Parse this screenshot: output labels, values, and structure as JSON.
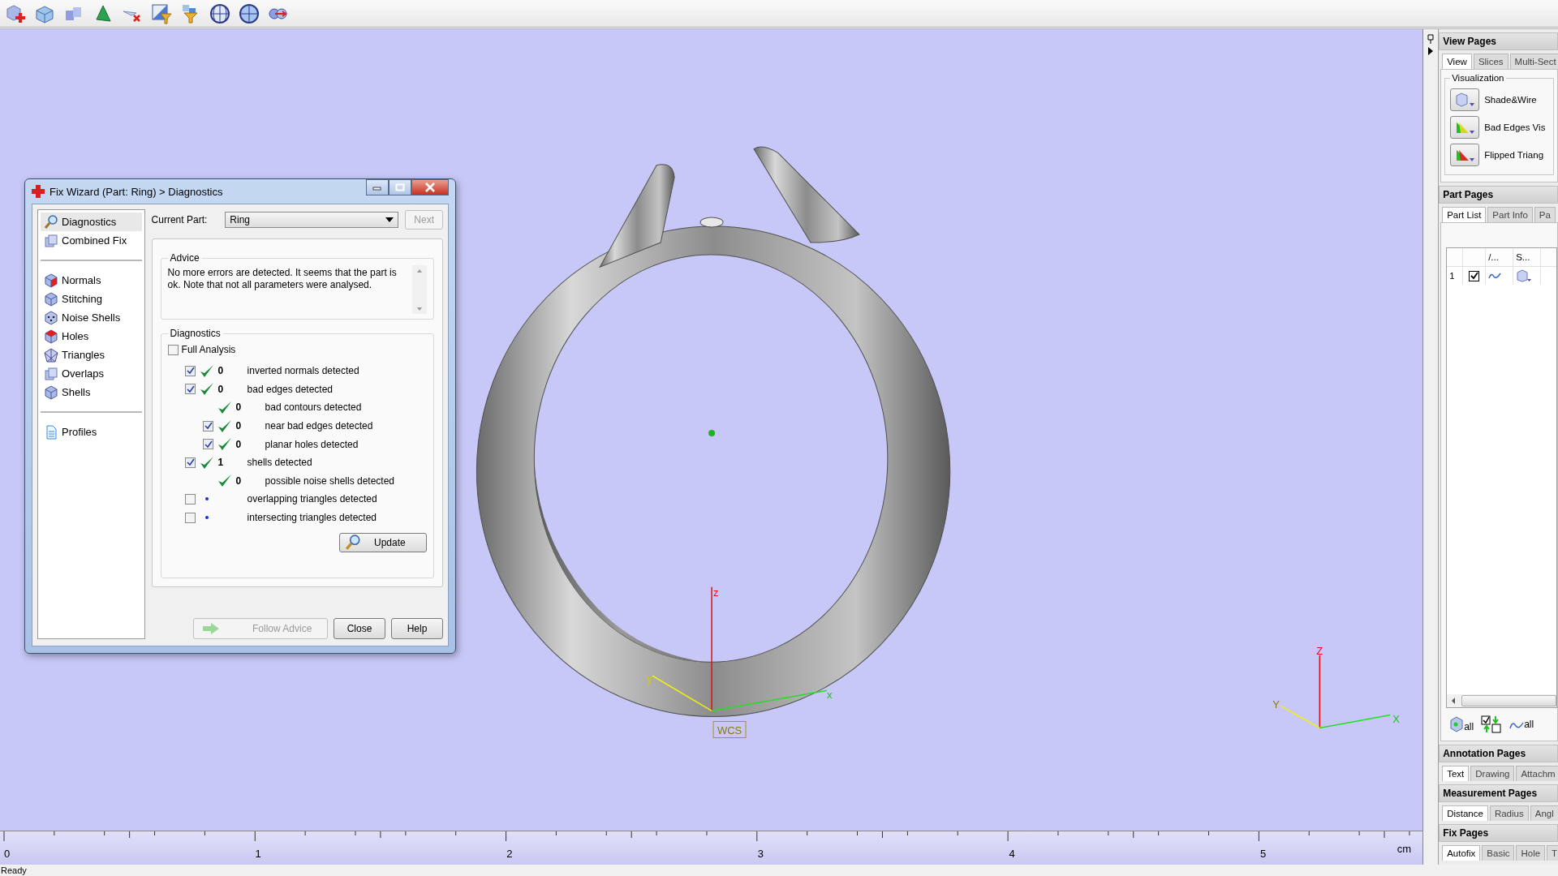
{
  "viewport": {
    "axis_labels": {
      "z": "z",
      "x": "x",
      "y": "y",
      "wcs": "WCS"
    },
    "corner_axes": {
      "z": "Z",
      "x": "X",
      "y": "Y"
    },
    "ruler": {
      "labels": [
        "0",
        "1",
        "2",
        "3",
        "4",
        "5"
      ],
      "unit": "cm"
    }
  },
  "dialog": {
    "title": "Fix Wizard (Part: Ring) > Diagnostics",
    "nav": [
      {
        "label": "Diagnostics",
        "selected": true
      },
      {
        "label": "Combined Fix",
        "selected": false
      },
      {
        "label": "Normals",
        "selected": false
      },
      {
        "label": "Stitching",
        "selected": false
      },
      {
        "label": "Noise Shells",
        "selected": false
      },
      {
        "label": "Holes",
        "selected": false
      },
      {
        "label": "Triangles",
        "selected": false
      },
      {
        "label": "Overlaps",
        "selected": false
      },
      {
        "label": "Shells",
        "selected": false
      },
      {
        "label": "Profiles",
        "selected": false
      }
    ],
    "current_part_label": "Current Part:",
    "current_part": "Ring",
    "next_button": {
      "label": "Next",
      "disabled": true
    },
    "advice": {
      "title": "Advice",
      "text": "No more errors are detected. It seems that the part is ok. Note that not all parameters were analysed."
    },
    "diagnostics": {
      "title": "Diagnostics",
      "full_analysis": {
        "label": "Full Analysis",
        "checked": false
      },
      "rows": [
        {
          "kind": "checkbox",
          "checked": true,
          "analysed": true,
          "count": "0",
          "label": "inverted normals detected"
        },
        {
          "kind": "checkbox",
          "checked": true,
          "analysed": true,
          "count": "0",
          "label": "bad edges detected",
          "children": [
            {
              "kind": "plain",
              "analysed": true,
              "count": "0",
              "label": "bad contours detected"
            },
            {
              "kind": "checkbox",
              "checked": true,
              "analysed": true,
              "count": "0",
              "label": "near bad edges detected"
            },
            {
              "kind": "checkbox",
              "checked": true,
              "analysed": true,
              "count": "0",
              "label": "planar holes detected"
            }
          ]
        },
        {
          "kind": "checkbox",
          "checked": true,
          "analysed": true,
          "count": "1",
          "label": "shells detected",
          "children": [
            {
              "kind": "plain",
              "analysed": true,
              "count": "0",
              "label": "possible noise shells detected"
            }
          ]
        },
        {
          "kind": "checkbox",
          "checked": false,
          "analysed": false,
          "label": "overlapping triangles detected"
        },
        {
          "kind": "checkbox",
          "checked": false,
          "analysed": false,
          "label": "intersecting triangles detected"
        }
      ],
      "update_button": "Update"
    },
    "buttons": [
      {
        "label": "Follow Advice",
        "disabled": true
      },
      {
        "label": "Close",
        "disabled": false
      },
      {
        "label": "Help",
        "disabled": false
      }
    ]
  },
  "side_panel": {
    "view_pages": {
      "title": "View Pages",
      "tabs": [
        {
          "label": "View",
          "selected": true
        },
        {
          "label": "Slices",
          "selected": false
        },
        {
          "label": "Multi-Sect",
          "selected": false
        }
      ],
      "group": "Visualization",
      "items": [
        {
          "label": "Shade&Wire"
        },
        {
          "label": "Bad Edges Vis"
        },
        {
          "label": "Flipped Triang"
        }
      ]
    },
    "part_pages": {
      "title": "Part Pages",
      "tabs": [
        {
          "label": "Part List",
          "selected": true
        },
        {
          "label": "Part Info",
          "selected": false
        },
        {
          "label": "Pa",
          "selected": false
        }
      ],
      "columns": [
        "/...",
        "S..."
      ],
      "rows": [
        {
          "index": "1",
          "checked": true
        }
      ],
      "tool_labels": [
        "all",
        "all"
      ]
    },
    "sections": [
      {
        "title": "Annotation Pages",
        "tabs": [
          {
            "label": "Text",
            "selected": true
          },
          {
            "label": "Drawing",
            "selected": false
          },
          {
            "label": "Attachm",
            "selected": false
          }
        ]
      },
      {
        "title": "Measurement Pages",
        "tabs": [
          {
            "label": "Distance",
            "selected": true
          },
          {
            "label": "Radius",
            "selected": false
          },
          {
            "label": "Angl",
            "selected": false
          }
        ]
      },
      {
        "title": "Fix Pages",
        "tabs": [
          {
            "label": "Autofix",
            "selected": true
          },
          {
            "label": "Basic",
            "selected": false
          },
          {
            "label": "Hole",
            "selected": false
          },
          {
            "label": "T",
            "selected": false
          }
        ]
      }
    ]
  },
  "status_bar": {
    "text": "Ready"
  }
}
